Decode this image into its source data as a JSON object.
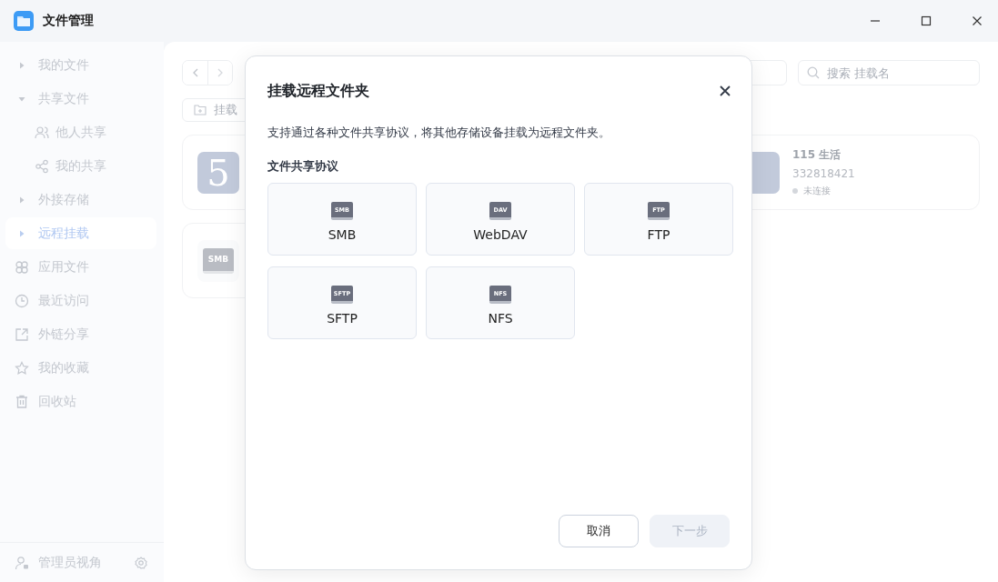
{
  "window": {
    "title": "文件管理"
  },
  "sidebar": {
    "items": [
      {
        "label": "我的文件",
        "kind": "group",
        "expanded": false,
        "selected": false
      },
      {
        "label": "共享文件",
        "kind": "group",
        "expanded": true,
        "selected": false,
        "children": [
          {
            "label": "他人共享",
            "selected": false
          },
          {
            "label": "我的共享",
            "selected": false
          }
        ]
      },
      {
        "label": "外接存储",
        "kind": "group",
        "expanded": false,
        "selected": false
      },
      {
        "label": "远程挂载",
        "kind": "group",
        "expanded": false,
        "selected": true
      },
      {
        "label": "应用文件",
        "kind": "link",
        "selected": false
      },
      {
        "label": "最近访问",
        "kind": "link",
        "selected": false
      },
      {
        "label": "外链分享",
        "kind": "link",
        "selected": false
      },
      {
        "label": "我的收藏",
        "kind": "link",
        "selected": false
      },
      {
        "label": "回收站",
        "kind": "link",
        "selected": false
      }
    ],
    "footer": {
      "label": "管理员视角"
    }
  },
  "toolbar": {
    "search": {
      "placeholder": "搜索 挂载名"
    },
    "mount_button": "挂载"
  },
  "mounts": [
    {
      "kind": "cloud",
      "icon_text": "5"
    },
    {
      "kind": "cloud",
      "name": "115 生活",
      "account": "332818421",
      "status": "未连接"
    },
    {
      "kind": "smb",
      "icon_text": "SMB"
    }
  ],
  "dialog": {
    "title": "挂载远程文件夹",
    "description": "支持通过各种文件共享协议，将其他存储设备挂载为远程文件夹。",
    "section": "文件共享协议",
    "protocols": [
      {
        "badge": "SMB",
        "label": "SMB",
        "selected": false
      },
      {
        "badge": "DAV",
        "label": "WebDAV",
        "selected": false
      },
      {
        "badge": "FTP",
        "label": "FTP",
        "selected": false
      },
      {
        "badge": "SFTP",
        "label": "SFTP",
        "selected": false
      },
      {
        "badge": "NFS",
        "label": "NFS",
        "selected": false
      }
    ],
    "buttons": [
      {
        "label": "取消",
        "disabled": false,
        "kind": "secondary"
      },
      {
        "label": "下一步",
        "disabled": true,
        "kind": "primary"
      }
    ]
  }
}
